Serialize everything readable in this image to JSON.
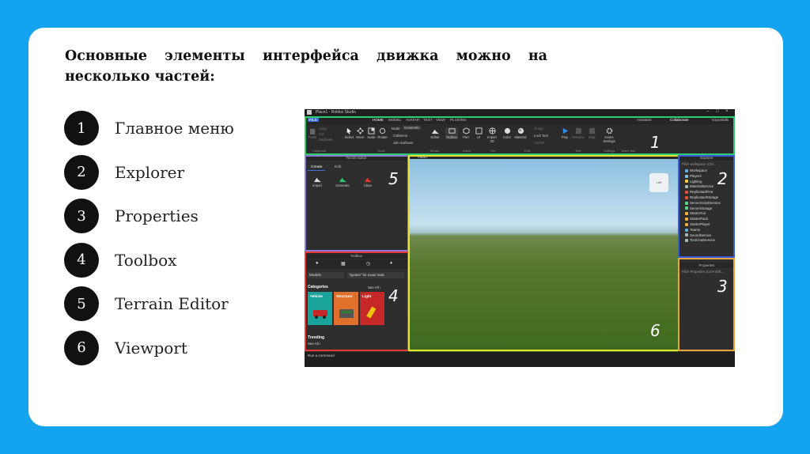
{
  "slide": {
    "title": "Основные элементы интерфейса движка можно на несколько частей:",
    "items": [
      {
        "num": "1",
        "label": "Главное меню"
      },
      {
        "num": "2",
        "label": "Explorer"
      },
      {
        "num": "3",
        "label": "Properties"
      },
      {
        "num": "4",
        "label": "Toolbox"
      },
      {
        "num": "5",
        "label": "Terrain Editor"
      },
      {
        "num": "6",
        "label": "Viewport"
      }
    ]
  },
  "studio": {
    "window_title": "Place1 - Roblox Studio",
    "menu": [
      "FILE",
      "HOME",
      "MODEL",
      "AVATAR",
      "TEST",
      "VIEW",
      "PLUGINS"
    ],
    "assistant": "Assistant",
    "collaborate": "Collaborate",
    "user": "ExpoSkills",
    "ribbon": {
      "clipboard": [
        "Paste",
        "Copy",
        "Cut",
        "Duplicate"
      ],
      "tools": [
        "Select",
        "Move",
        "Scale",
        "Rotate"
      ],
      "mode_label": "Mode:",
      "mode_value": "Geometric",
      "collisions": "Collisions",
      "join_surfaces": "Join Surfaces",
      "items": [
        "Editor",
        "Toolbox",
        "Part",
        "UI",
        "Import 3D",
        "Color",
        "Material"
      ],
      "group_label": "Group",
      "lock_tool": "Lock Tool",
      "anchor": "Anchor",
      "play": "Play",
      "resume": "Resume",
      "stop": "Stop",
      "game_settings": "Game Settings",
      "groups": [
        "Clipboard",
        "Tools",
        "Terrain",
        "Insert",
        "File",
        "Edit",
        "Test",
        "Settings",
        "Team Test"
      ]
    },
    "terrain_editor": {
      "title": "Terrain Editor",
      "tabs": [
        "Create",
        "Edit"
      ],
      "actions": [
        "Import",
        "Generate",
        "Clear"
      ]
    },
    "toolbox": {
      "title": "Toolbox",
      "category_select": "Models",
      "search_placeholder": "\"quotes\" for exact matc",
      "categories_label": "Categories",
      "see_all": "See All ›",
      "tiles": [
        "Vehicle",
        "Structure",
        "Light"
      ],
      "trending_label": "Trending",
      "trending_see_all": "See All ›"
    },
    "viewport": {
      "tab": "Place1",
      "cube_label": "Left"
    },
    "explorer": {
      "title": "Explorer",
      "filter": "Filter workspace (Ctrl...",
      "items": [
        "Workspace",
        "Players",
        "Lighting",
        "MaterialService",
        "ReplicatedFirst",
        "ReplicatedStorage",
        "ServerScriptService",
        "ServerStorage",
        "StarterGui",
        "StarterPack",
        "StarterPlayer",
        "Teams",
        "SoundService",
        "TextChatService"
      ]
    },
    "properties": {
      "title": "Properties",
      "filter": "Filter Properties (Ctrl+Shift..."
    },
    "command_bar": "Run a command",
    "annotations": [
      "1",
      "2",
      "3",
      "4",
      "5",
      "6"
    ],
    "colors": {
      "menu": "#2ecc71",
      "explorer": "#3a5bd9",
      "properties": "#e8a33c",
      "toolbox": "#e53935",
      "terrain": "#8a7bd8",
      "viewport": "#e8e13a"
    }
  }
}
